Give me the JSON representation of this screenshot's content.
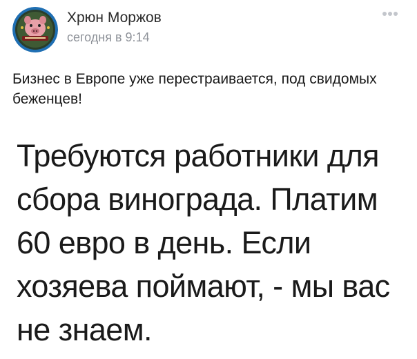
{
  "post": {
    "author": {
      "name": "Хрюн Моржов",
      "avatar_icon": "pig-avatar-icon"
    },
    "time": "сегодня в 9:14",
    "more_icon": "more-dots-icon",
    "caption": "Бизнес в Европе уже перестраивается, под свидомых беженцев!",
    "image_text": "Требуются работники для сбора винограда. Платим 60 евро в день. Если хозяева поймают, - мы вас не знаем."
  },
  "colors": {
    "time_text": "#8e9299",
    "avatar_ring": "#1f6fb3",
    "avatar_bg": "#2a3d2a",
    "dots": "#c3c6cc"
  }
}
